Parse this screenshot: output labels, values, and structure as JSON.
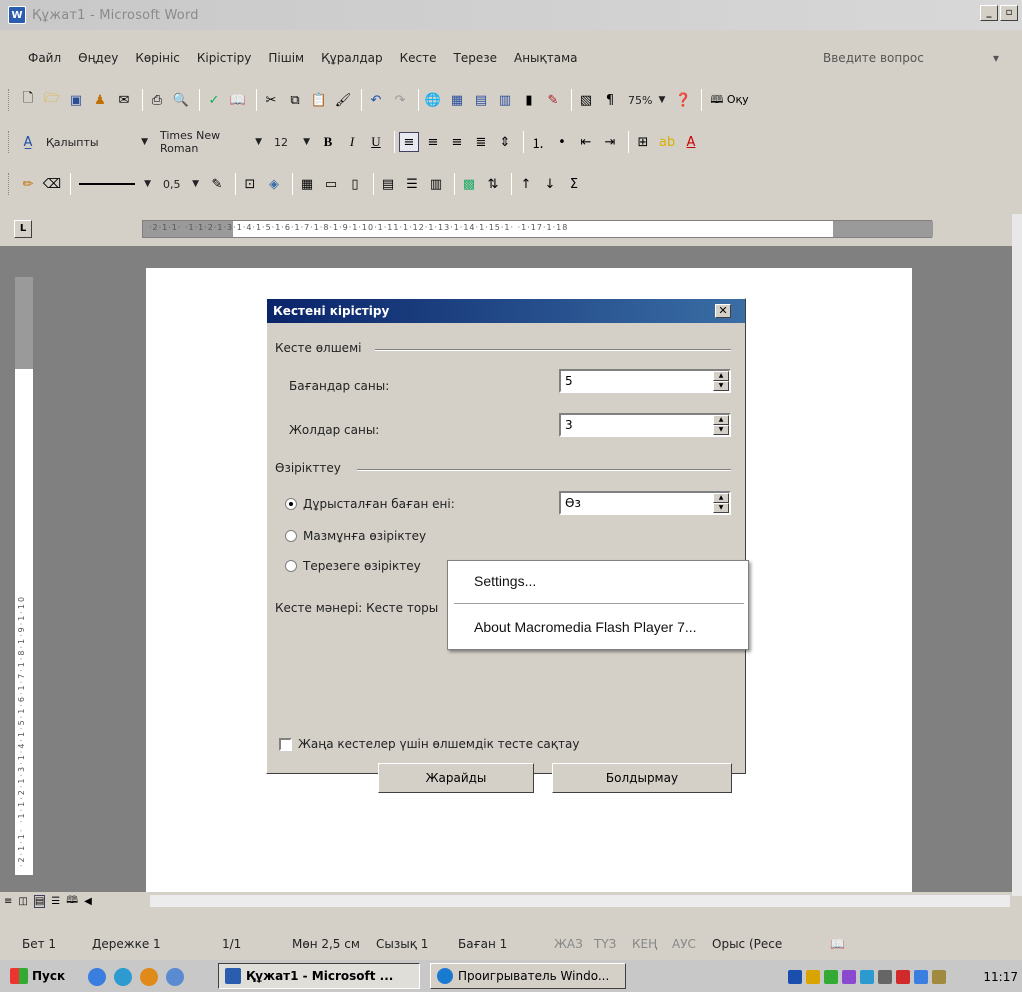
{
  "window": {
    "title": "Құжат1 - Microsoft Word"
  },
  "menu": {
    "items": [
      "Файл",
      "Өңдеу",
      "Көрініс",
      "Кірістіру",
      "Пішім",
      "Құралдар",
      "Кесте",
      "Терезе",
      "Анықтама"
    ],
    "help_placeholder": "Введите вопрос"
  },
  "toolbar": {
    "zoom": "75%",
    "read_label": "Оқу",
    "style": "Қалыпты",
    "font": "Times New Roman",
    "size": "12",
    "line_weight": "0,5"
  },
  "ruler": {
    "ticks": "·2·1·1·  ·1·1·2·1·3·1·4·1·5·1·6·1·7·1·8·1·9·1·10·1·11·1·12·1·13·1·14·1·15·1· ·1·17·1·18"
  },
  "vruler": {
    "ticks": "·2·1·1·  ·1·1·2·1·3·1·4·1·5·1·6·1·7·1·8·1·9·1·10"
  },
  "dialog": {
    "title": "Кестені кірістіру",
    "size_group": "Кесте өлшемі",
    "columns_label": "Бағандар саны:",
    "columns_value": "5",
    "rows_label": "Жолдар саны:",
    "rows_value": "3",
    "autofit_group": "Өзірікттеу",
    "radio_fixed": "Дұрысталған баған ені:",
    "fixed_value": "Өз",
    "radio_content": "Мазмұнға өзіріктеу",
    "radio_window": "Терезеге өзіріктеу",
    "style_label": "Кесте мәнері: Кесте торы",
    "remember": "Жаңа кестелер үшін өлшемдік тесте сақтау",
    "ok": "Жарайды",
    "cancel": "Болдырмау"
  },
  "context_menu": {
    "items": [
      "Settings...",
      "About Macromedia Flash Player 7..."
    ]
  },
  "status": {
    "page": "Бет 1",
    "section": "Дережке 1",
    "pages": "1/1",
    "position": "Мөн 2,5 см",
    "line": "Сызық 1",
    "column": "Баған 1",
    "rec": "ЖАЗ",
    "trk": "ТҮЗ",
    "ext": "КЕҢ",
    "ovr": "АУС",
    "lang": "Орыс (Ресе"
  },
  "taskbar": {
    "start": "Пуск",
    "task1": "Құжат1 - Microsoft ...",
    "task2": "Проигрыватель Windo...",
    "clock": "11:17"
  }
}
